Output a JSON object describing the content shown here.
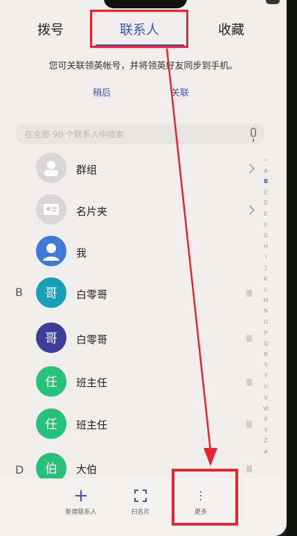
{
  "tabs": [
    {
      "label": "拨号"
    },
    {
      "label": "联系人"
    },
    {
      "label": "收藏"
    }
  ],
  "notice": {
    "text": "您可关联领英帐号，并将领英好友同步到手机。",
    "later": "稍后",
    "link": "关联"
  },
  "search": {
    "placeholder": "在全部 90 个联系人中搜索"
  },
  "contacts": [
    {
      "name": "群组",
      "icon": "group-icon"
    },
    {
      "name": "名片夹",
      "icon": "business-card-icon"
    },
    {
      "name": "我",
      "icon": "person-icon"
    },
    {
      "section": "B",
      "avatar": "哥",
      "name": "白零哥"
    },
    {
      "avatar": "哥",
      "name": "白零哥"
    },
    {
      "avatar": "任",
      "name": "班主任"
    },
    {
      "avatar": "任",
      "name": "班主任"
    },
    {
      "section": "D",
      "avatar": "伯",
      "name": "大伯"
    }
  ],
  "alphabet": [
    "☆",
    "A",
    "B",
    "C",
    "D",
    "E",
    "F",
    "G",
    "H",
    "I",
    "J",
    "K",
    "L",
    "M",
    "N",
    "O",
    "P",
    "Q",
    "R",
    "S",
    "T",
    "U",
    "V",
    "W",
    "X",
    "Y",
    "Z",
    "#"
  ],
  "alphabet_active": "B",
  "bottom_actions": [
    {
      "label": "新建联系人",
      "icon": "plus-icon"
    },
    {
      "label": "扫名片",
      "icon": "scan-icon"
    },
    {
      "label": "更多",
      "icon": "more-icon"
    }
  ],
  "colors": {
    "accent": "#3a56b8",
    "highlight": "#e8232d"
  }
}
